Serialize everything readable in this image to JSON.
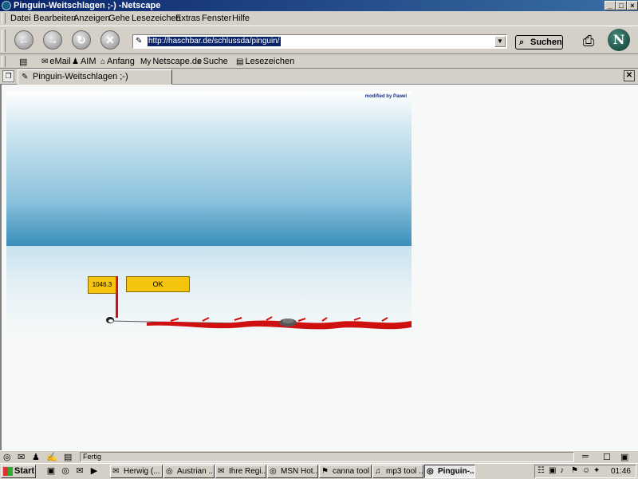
{
  "window": {
    "title": "Pinguin-Weitschlagen ;-) -Netscape",
    "controls": {
      "minimize": "_",
      "maximize": "□",
      "close": "×"
    }
  },
  "menu": [
    "Datei",
    "Bearbeiten",
    "Anzeigen",
    "Gehe",
    "Lesezeichen",
    "Extras",
    "Fenster",
    "Hilfe"
  ],
  "navbar": {
    "back_icon": "←",
    "forward_icon": "→",
    "reload_icon": "↻",
    "stop_icon": "✕",
    "url": "http://haschbar.de/schlussda/pinguin/",
    "search_label": "Suchen",
    "logo_letter": "N"
  },
  "personal_toolbar": {
    "items": [
      {
        "icon": "✉",
        "label": "eMail"
      },
      {
        "icon": "♟",
        "label": "AIM"
      },
      {
        "icon": "⌂",
        "label": "Anfang"
      },
      {
        "icon": "My",
        "label": "Netscape.de"
      },
      {
        "icon": "⌕",
        "label": "Suche"
      },
      {
        "icon": "▤",
        "label": "Lesezeichen"
      }
    ]
  },
  "tabs": [
    {
      "label": "Pinguin-Weitschlagen ;-)"
    }
  ],
  "game": {
    "credit": "modified by Pawel",
    "score": "1046.3",
    "ok_label": "OK",
    "colors": {
      "flag": "#d01010",
      "box": "#f5c40d",
      "blood": "#d01010"
    }
  },
  "status": {
    "text": "Fertig"
  },
  "taskbar": {
    "start_label": "Start",
    "tasks": [
      {
        "icon": "✉",
        "label": "Herwig (...",
        "active": false
      },
      {
        "icon": "◎",
        "label": "Austrian ...",
        "active": false
      },
      {
        "icon": "✉",
        "label": "Ihre Regi...",
        "active": false
      },
      {
        "icon": "◎",
        "label": "MSN Hot...",
        "active": false
      },
      {
        "icon": "⚑",
        "label": "canna tool",
        "active": false
      },
      {
        "icon": "♫",
        "label": "mp3 tool ...",
        "active": false
      },
      {
        "icon": "◎",
        "label": "Pinguin-...",
        "active": true
      }
    ],
    "clock": "01:46"
  }
}
